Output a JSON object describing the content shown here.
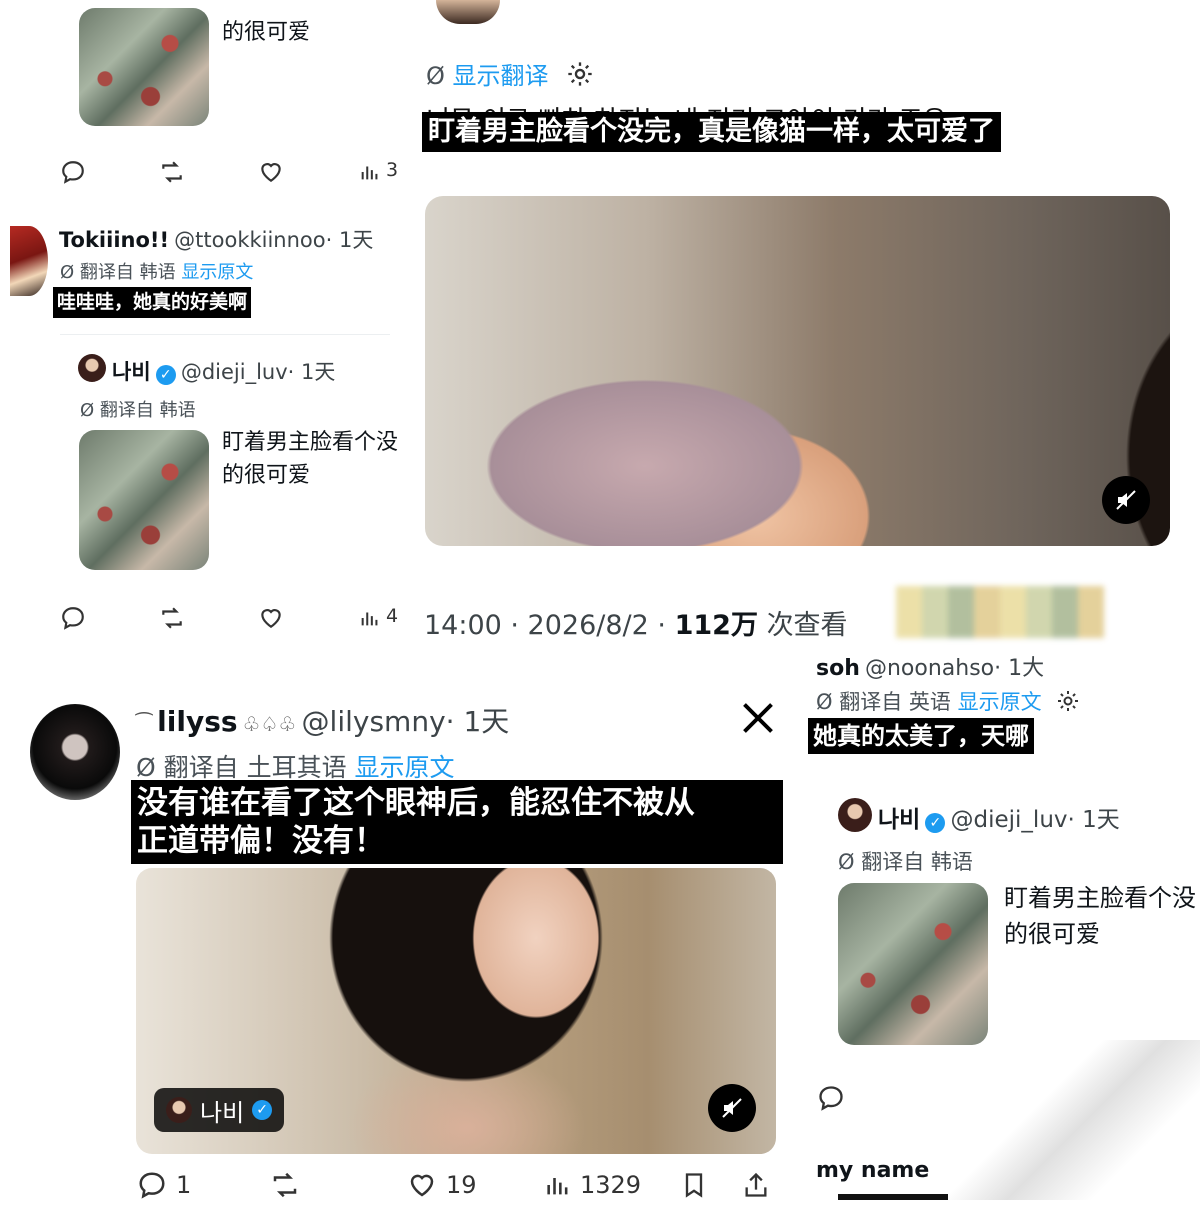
{
  "top_left": {
    "caption_tail": "的很可爱",
    "actions": {
      "views_partial": "3"
    }
  },
  "tokiiino": {
    "name": "Tokiiino!!",
    "handle": "@ttookkiinnoo",
    "time": "· 1天",
    "translated_from": "翻译自 韩语",
    "show_original": "显示原文",
    "text": "哇哇哇，她真的好美啊"
  },
  "quote_left": {
    "name": "나비",
    "handle": "@dieji_luv",
    "time": "· 1天",
    "translated_from": "翻译自 韩语",
    "text_line1": "盯着男主脸看个没",
    "text_line2": "的很可爱",
    "actions": {
      "views_partial": "4"
    }
  },
  "main_post": {
    "show_translation": "显示翻译",
    "korean_partial": "너무 이르 빠하 하지는 내 저기 그아이 기가 조우",
    "translation": "盯着男主脸看个没完，真是像猫一样，太可爱了",
    "timestamp": "14:00 · 2026/8/2 ·",
    "views_count": "112万",
    "views_label": "次查看"
  },
  "lilyss": {
    "name": "lilyss",
    "handle": "@lilysmny",
    "time": "· 1天",
    "translated_from": "翻译自 土耳其语",
    "show_original": "显示原文",
    "text_line1": "没有谁在看了这个眼神后，能忍住不被从",
    "text_line2": "正道带偏！没有！",
    "video_tag": "나비",
    "actions": {
      "replies": "1",
      "likes": "19",
      "views": "1329"
    },
    "x_logo": "X"
  },
  "soh": {
    "name": "soh",
    "handle": "@noonahso",
    "time": "· 1大",
    "translated_from": "翻译自 英语",
    "show_original": "显示原文",
    "text": "她真的太美了，天哪",
    "quote_name": "나비",
    "quote_handle": "@dieji_luv",
    "quote_time": "· 1天",
    "quote_translated_from": "翻译自 韩语",
    "quote_text_line1": "盯着男主脸看个没",
    "quote_text_line2": "的很可爱",
    "next_user": "my name"
  },
  "colors": {
    "accent": "#1d9bf0",
    "text": "#0f1419",
    "muted": "#536471"
  }
}
